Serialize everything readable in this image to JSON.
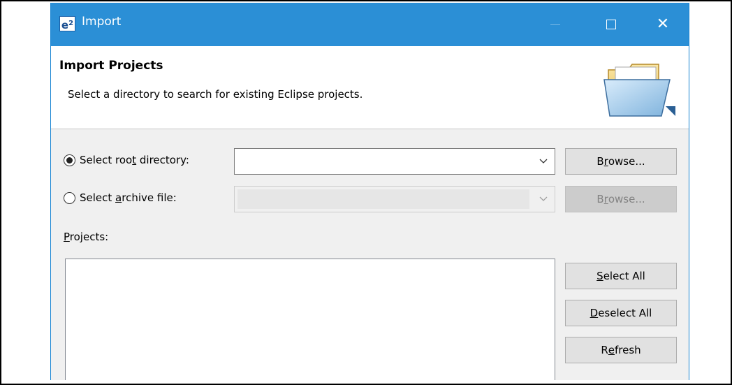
{
  "window": {
    "title": "Import",
    "app_icon_text": "e",
    "app_icon_sup": "2"
  },
  "header": {
    "title": "Import Projects",
    "description": "Select a directory to search for existing Eclipse projects."
  },
  "form": {
    "root_dir": {
      "label_pre": "Select roo",
      "label_mnemonic": "t",
      "label_post": " directory:",
      "selected": true,
      "value": ""
    },
    "archive": {
      "label_pre": "Select ",
      "label_mnemonic": "a",
      "label_post": "rchive file:",
      "selected": false,
      "value": ""
    },
    "browse_pre": "B",
    "browse_mnemonic": "r",
    "browse_post": "owse...",
    "projects_mnemonic": "P",
    "projects_post": "rojects:"
  },
  "buttons": {
    "select_all_mnemonic": "S",
    "select_all_post": "elect All",
    "deselect_all_mnemonic": "D",
    "deselect_all_post": "eselect All",
    "refresh_pre": "R",
    "refresh_mnemonic": "e",
    "refresh_post": "fresh"
  },
  "icons": {
    "app": "eclipse-e2-icon",
    "minimize": "minimize-icon",
    "maximize": "maximize-icon",
    "close": "close-icon",
    "folder": "open-folder-icon",
    "dropdown": "chevron-down-icon"
  },
  "colors": {
    "titlebar": "#2b8fd6",
    "dialog_bg": "#f0f0f0",
    "button_bg": "#e1e1e1"
  }
}
